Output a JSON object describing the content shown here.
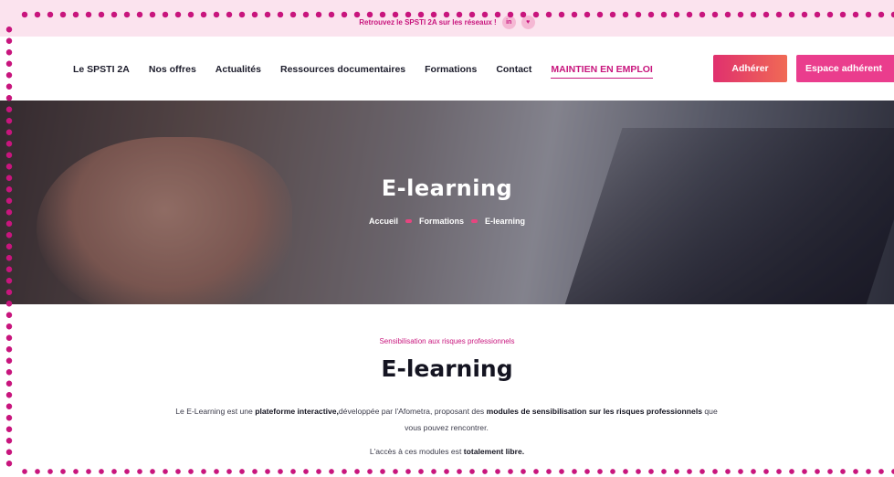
{
  "topbar": {
    "text": "Retrouvez le SPSTI 2A sur les réseaux !",
    "social": [
      {
        "name": "linkedin-icon",
        "glyph": "in"
      },
      {
        "name": "twitter-icon",
        "glyph": "♥"
      }
    ]
  },
  "nav": {
    "links": [
      {
        "label": "Le SPSTI 2A"
      },
      {
        "label": "Nos offres"
      },
      {
        "label": "Actualités"
      },
      {
        "label": "Ressources documentaires"
      },
      {
        "label": "Formations"
      },
      {
        "label": "Contact"
      },
      {
        "label": "MAINTIEN EN EMPLOI",
        "active": true
      }
    ],
    "adherer_label": "Adhérer",
    "espace_label": "Espace adhérent"
  },
  "hero": {
    "title": "E-learning",
    "breadcrumb": [
      "Accueil",
      "Formations",
      "E-learning"
    ]
  },
  "content": {
    "eyebrow": "Sensibilisation aux risques professionnels",
    "title": "E-learning",
    "para1": {
      "t1": "Le E-Learning est une ",
      "b1": "plateforme interactive,",
      "t2": "développée par l'Afometra, proposant des ",
      "b2": "modules de sensibilisation sur les risques professionnels",
      "t3": " que vous pouvez rencontrer."
    },
    "para2": {
      "t1": "L'accès à ces modules est ",
      "b1": "totalement libre."
    }
  },
  "colors": {
    "accent": "#c8157d",
    "topbar_bg": "#fbe3ee",
    "button_gradient_start": "#e0306e",
    "button_gradient_end": "#f06a55",
    "button_pink": "#ea3d8d"
  }
}
